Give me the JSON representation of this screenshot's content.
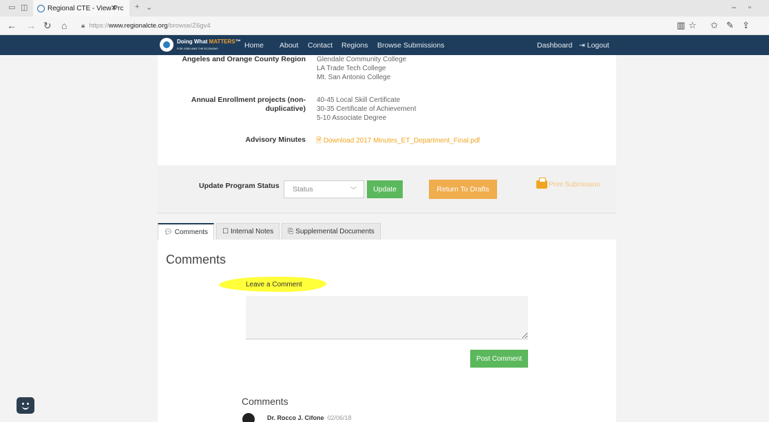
{
  "browser": {
    "tab_title": "Regional CTE - View Prc",
    "url_prefix": "https://",
    "url_host": "www.regionalcte.org",
    "url_path": "/browse/Z6gv4"
  },
  "navbar": {
    "brand_line1": "Doing What",
    "brand_highlight": "MATTERS",
    "brand_line2": "FOR JOBS AND THE ECONOMY",
    "links": [
      "Home",
      "About",
      "Contact",
      "Regions",
      "Browse Submissions"
    ],
    "dashboard": "Dashboard",
    "logout": "Logout"
  },
  "details": {
    "region_label": "Angeles and Orange County Region",
    "colleges": [
      "Glendale Community College",
      "LA Trade Tech College",
      "Mt. San Antonio College"
    ],
    "enrollment_label_1": "Annual Enrollment projects (non-",
    "enrollment_label_2": "duplicative)",
    "enrollment": [
      "40-45 Local Skill Certificate",
      "30-35 Certificate of Achievement",
      "5-10 Associate Degree"
    ],
    "minutes_label": "Advisory Minutes",
    "minutes_link": "Download 2017 Minutes_ET_Department_Final.pdf"
  },
  "status": {
    "label": "Update Program Status",
    "select_value": "Status",
    "update_btn": "Update",
    "drafts_btn": "Return To Drafts",
    "print": "Print Submission"
  },
  "tabs": [
    "Comments",
    "Internal Notes",
    "Supplemental Documents"
  ],
  "comments": {
    "heading": "Comments",
    "leave": "Leave a Comment",
    "post_btn": "Post Comment",
    "list_heading": "Comments",
    "first_author": "Dr. Rocco J. Cifone",
    "first_date": "· 02/06/18"
  },
  "colors": {
    "navbar": "#1e3d5c",
    "green": "#5cb85c",
    "orange": "#f0ad4e",
    "link": "#f0a520"
  }
}
